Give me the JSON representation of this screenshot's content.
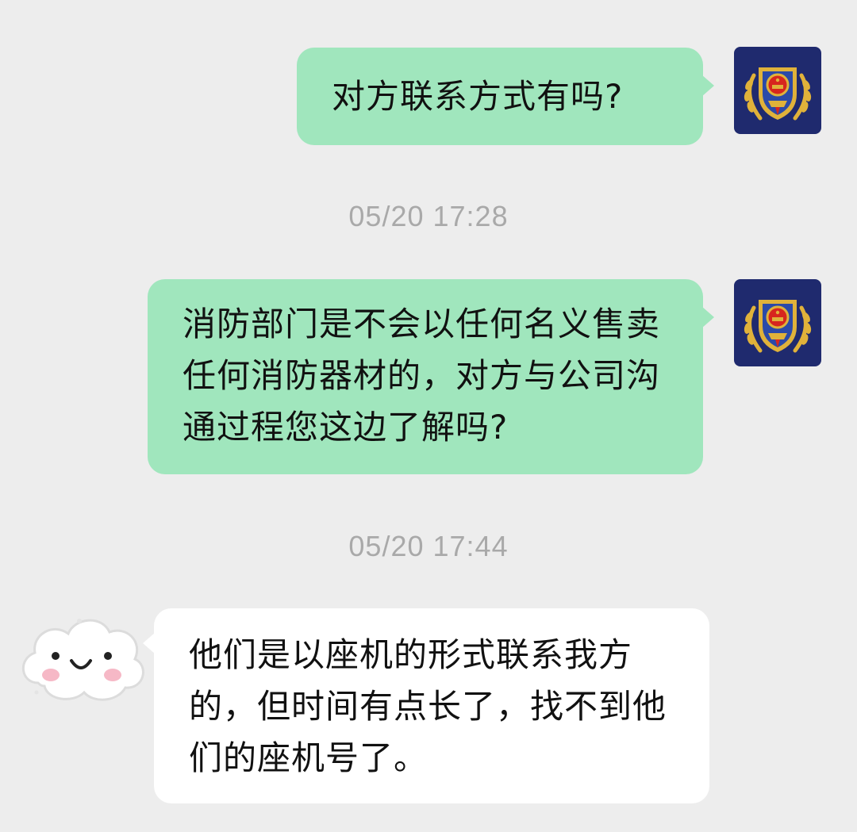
{
  "messages": [
    {
      "sender": "self",
      "text": "对方联系方式有吗?"
    },
    {
      "sender": "self",
      "text": "消防部门是不会以任何名义售卖任何消防器材的，对方与公司沟通过程您这边了解吗?"
    },
    {
      "sender": "other",
      "text": "他们是以座机的形式联系我方的，但时间有点长了，找不到他们的座机号了。"
    }
  ],
  "timestamps": [
    "05/20 17:28",
    "05/20 17:44"
  ],
  "colors": {
    "background": "#ededed",
    "self_bubble": "#a0e6bd",
    "other_bubble": "#ffffff",
    "timestamp_text": "#a9a9a9",
    "badge_navy": "#1f2a6e",
    "badge_gold": "#e0b23a",
    "badge_red": "#d7261e",
    "cheek_pink": "#f6b8c6"
  },
  "avatars": {
    "self": "fire-rescue-emblem-icon",
    "other": "cloud-smiley-icon"
  }
}
